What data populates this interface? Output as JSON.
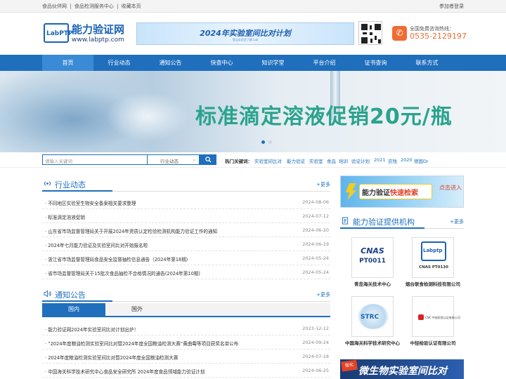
{
  "topbar": {
    "links": [
      "食品伙伴网",
      "食品检测服务中心",
      "收藏本页"
    ],
    "separator": "|",
    "login": "参加者登录"
  },
  "header": {
    "logo_badge": "LabPTP",
    "logo_cn": "能力验证网",
    "logo_url": "www.labptp.com",
    "banner_text": "2024年实验室间比对计划",
    "banner_sub": "食品实验室了解 Lab",
    "hotline_label": "全国免费咨询热线：",
    "hotline_number": "0535-2129197"
  },
  "nav": [
    "首页",
    "行业动态",
    "通知公告",
    "快查中心",
    "知识学堂",
    "平台介绍",
    "证书查询",
    "联系方式"
  ],
  "hero": {
    "text": "标准滴定溶液促销20元/瓶"
  },
  "search": {
    "placeholder": "请输入关键词",
    "category": "行业动态",
    "hot_label": "热门关键词：",
    "keywords": [
      "实验室间比对",
      "能力验证",
      "实验室",
      "食品",
      "培训",
      "验证计划",
      "2021",
      "农残",
      "2020",
      "德国Dr"
    ]
  },
  "industry": {
    "title": "行业动态",
    "more": "+更多",
    "items": [
      {
        "title": "· 不同地区实验室生物安全备案相关要求整理",
        "date": "2024-08-06"
      },
      {
        "title": "· 标准滴定溶液促销",
        "date": "2024-07-12"
      },
      {
        "title": "· 山东省市场监督管理局关于开展2024年资质认定检验检测机构能力验证工作的通知",
        "date": "2024-06-20"
      },
      {
        "title": "· 2024年七月能力验证及实验室间比对开始报名啦",
        "date": "2024-06-19"
      },
      {
        "title": "· 浙江省市场监督管理局食品安全监督抽检信息通告（2024年第18期）",
        "date": "2024-05-24"
      },
      {
        "title": "· 省市场监督管理局关于15批次食品抽检不合格情况的通告(2024年第10期)",
        "date": "2024-05-24"
      }
    ]
  },
  "notice": {
    "title": "通知公告",
    "more": "+更多",
    "tabs": [
      "国内",
      "国外"
    ],
    "items": [
      {
        "title": "· 能力验证网2024年实验室间比对计划出炉！",
        "date": "2023-12-12"
      },
      {
        "title": "· “2024年度粮油检测实验室间比对暨2024年度全国粮油检测大赛”黄曲霉等项目获奖名单公布",
        "date": "2024-09-24"
      },
      {
        "title": "· 2024年度粮油检测实验室间比对暨2024年度全国粮油检测大赛",
        "date": "2024-07-18"
      },
      {
        "title": "· 中国海关科学技术研究中心食品安全研究所 2024年度食品领域能力验证计划",
        "date": "2024-06-25"
      }
    ]
  },
  "side": {
    "banner_text_a": "能力验证",
    "banner_text_b": "快速检索",
    "banner_cta": "点击进入",
    "providers_title": "能力验证提供机构",
    "providers_more": "+更多",
    "providers": [
      {
        "name": "青岛海关技术中心",
        "logo_text": "CNAS",
        "logo_code": "PT0011"
      },
      {
        "name": "烟台联食检测科技有限公司",
        "logo_text": "Labptp",
        "logo_code": "CNAS PT0130"
      },
      {
        "name": "中国海关科学技术研究中心",
        "logo_text": "STRC"
      },
      {
        "name": "中轻检验认证有限公司",
        "logo_text": "CNC 中轻检验认证有限公司"
      }
    ],
    "bottom_banner_tag": "强化",
    "bottom_banner_text": "微生物实验室间比对"
  },
  "colors": {
    "primary": "#1f6fbd",
    "accent": "#ef6c33",
    "hero_text": "#2aa38d"
  }
}
